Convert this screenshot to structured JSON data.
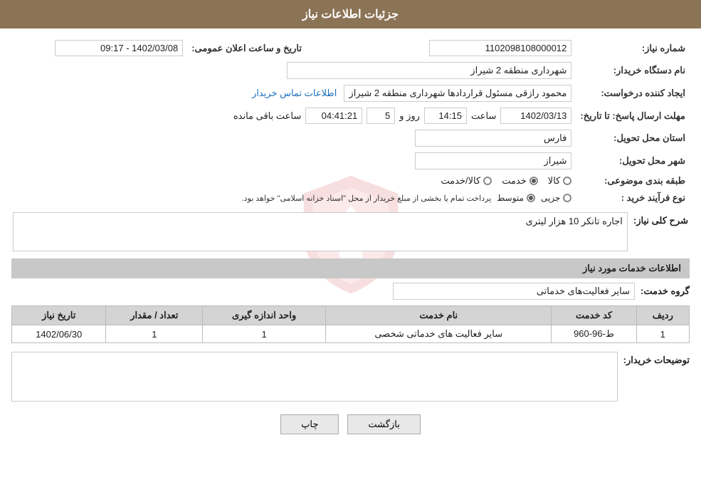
{
  "header": {
    "title": "جزئیات اطلاعات نیاز"
  },
  "fields": {
    "niyaz_number_label": "شماره نیاز:",
    "niyaz_number_value": "1102098108000012",
    "buyer_org_label": "نام دستگاه خریدار:",
    "buyer_org_value": "شهرداری منطقه 2 شیراز",
    "creator_label": "ایجاد کننده درخواست:",
    "creator_value": "محمود رازقی مسئول قراردادها شهرداری منطقه 2 شیراز",
    "creator_link": "اطلاعات تماس خریدار",
    "announce_date_label": "تاریخ و ساعت اعلان عمومی:",
    "announce_date_value": "1402/03/08 - 09:17",
    "response_deadline_label": "مهلت ارسال پاسخ: تا تاریخ:",
    "response_date": "1402/03/13",
    "response_time_label": "ساعت",
    "response_time": "14:15",
    "response_days_label": "روز و",
    "response_days": "5",
    "response_remaining_label": "ساعت باقی مانده",
    "response_remaining": "04:41:21",
    "province_label": "استان محل تحویل:",
    "province_value": "فارس",
    "city_label": "شهر محل تحویل:",
    "city_value": "شیراز",
    "category_label": "طبقه بندی موضوعی:",
    "category_options": [
      "کالا",
      "خدمت",
      "کالا/خدمت"
    ],
    "category_selected": "خدمت",
    "process_label": "نوع فرآیند خرید :",
    "process_options": [
      "جزیی",
      "متوسط"
    ],
    "process_selected": "متوسط",
    "process_note": "پرداخت تمام یا بخشی از مبلغ خریدار از محل \"اسناد خزانه اسلامی\" خواهد بود.",
    "description_label": "شرح کلی نیاز:",
    "description_value": "اجاره تانکر 10 هزار لیتری"
  },
  "services_section": {
    "title": "اطلاعات خدمات مورد نیاز",
    "service_group_label": "گروه خدمت:",
    "service_group_value": "سایر فعالیت‌های خدماتی",
    "table": {
      "headers": [
        "ردیف",
        "کد خدمت",
        "نام خدمت",
        "واحد اندازه گیری",
        "تعداد / مقدار",
        "تاریخ نیاز"
      ],
      "rows": [
        {
          "row": "1",
          "code": "ط-96-960",
          "name": "سایر فعالیت های خدماتی شخصی",
          "unit": "1",
          "quantity": "1",
          "date": "1402/06/30"
        }
      ]
    }
  },
  "buyer_notes_label": "توضیحات خریدار:",
  "buyer_notes_value": "",
  "buttons": {
    "print": "چاپ",
    "back": "بازگشت"
  }
}
